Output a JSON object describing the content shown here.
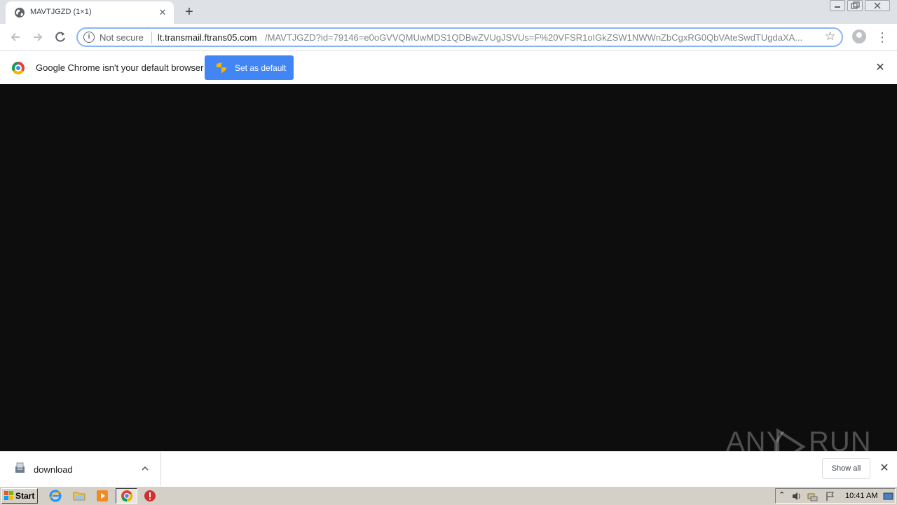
{
  "browser": {
    "tab": {
      "title": "MAVTJGZD (1×1)"
    },
    "address_bar": {
      "security_label": "Not secure",
      "host": "lt.transmail.ftrans05.com",
      "path": "/MAVTJGZD?id=79146=e0oGVVQMUwMDS1QDBwZVUgJSVUs=F%20VFSR1oIGkZSW1NWWnZbCgxRG0QbVAteSwdTUgdaXA..."
    },
    "infobar": {
      "message": "Google Chrome isn't your default browser",
      "button_label": "Set as default"
    },
    "download_shelf": {
      "item_name": "download",
      "show_all_label": "Show all"
    }
  },
  "watermark": {
    "text_left": "ANY",
    "text_right": "RUN"
  },
  "taskbar": {
    "start_label": "Start",
    "clock": "10:41 AM"
  },
  "colors": {
    "accent": "#4285f4",
    "content_bg": "#0d0d0d",
    "taskbar": "#d4d0c8"
  }
}
